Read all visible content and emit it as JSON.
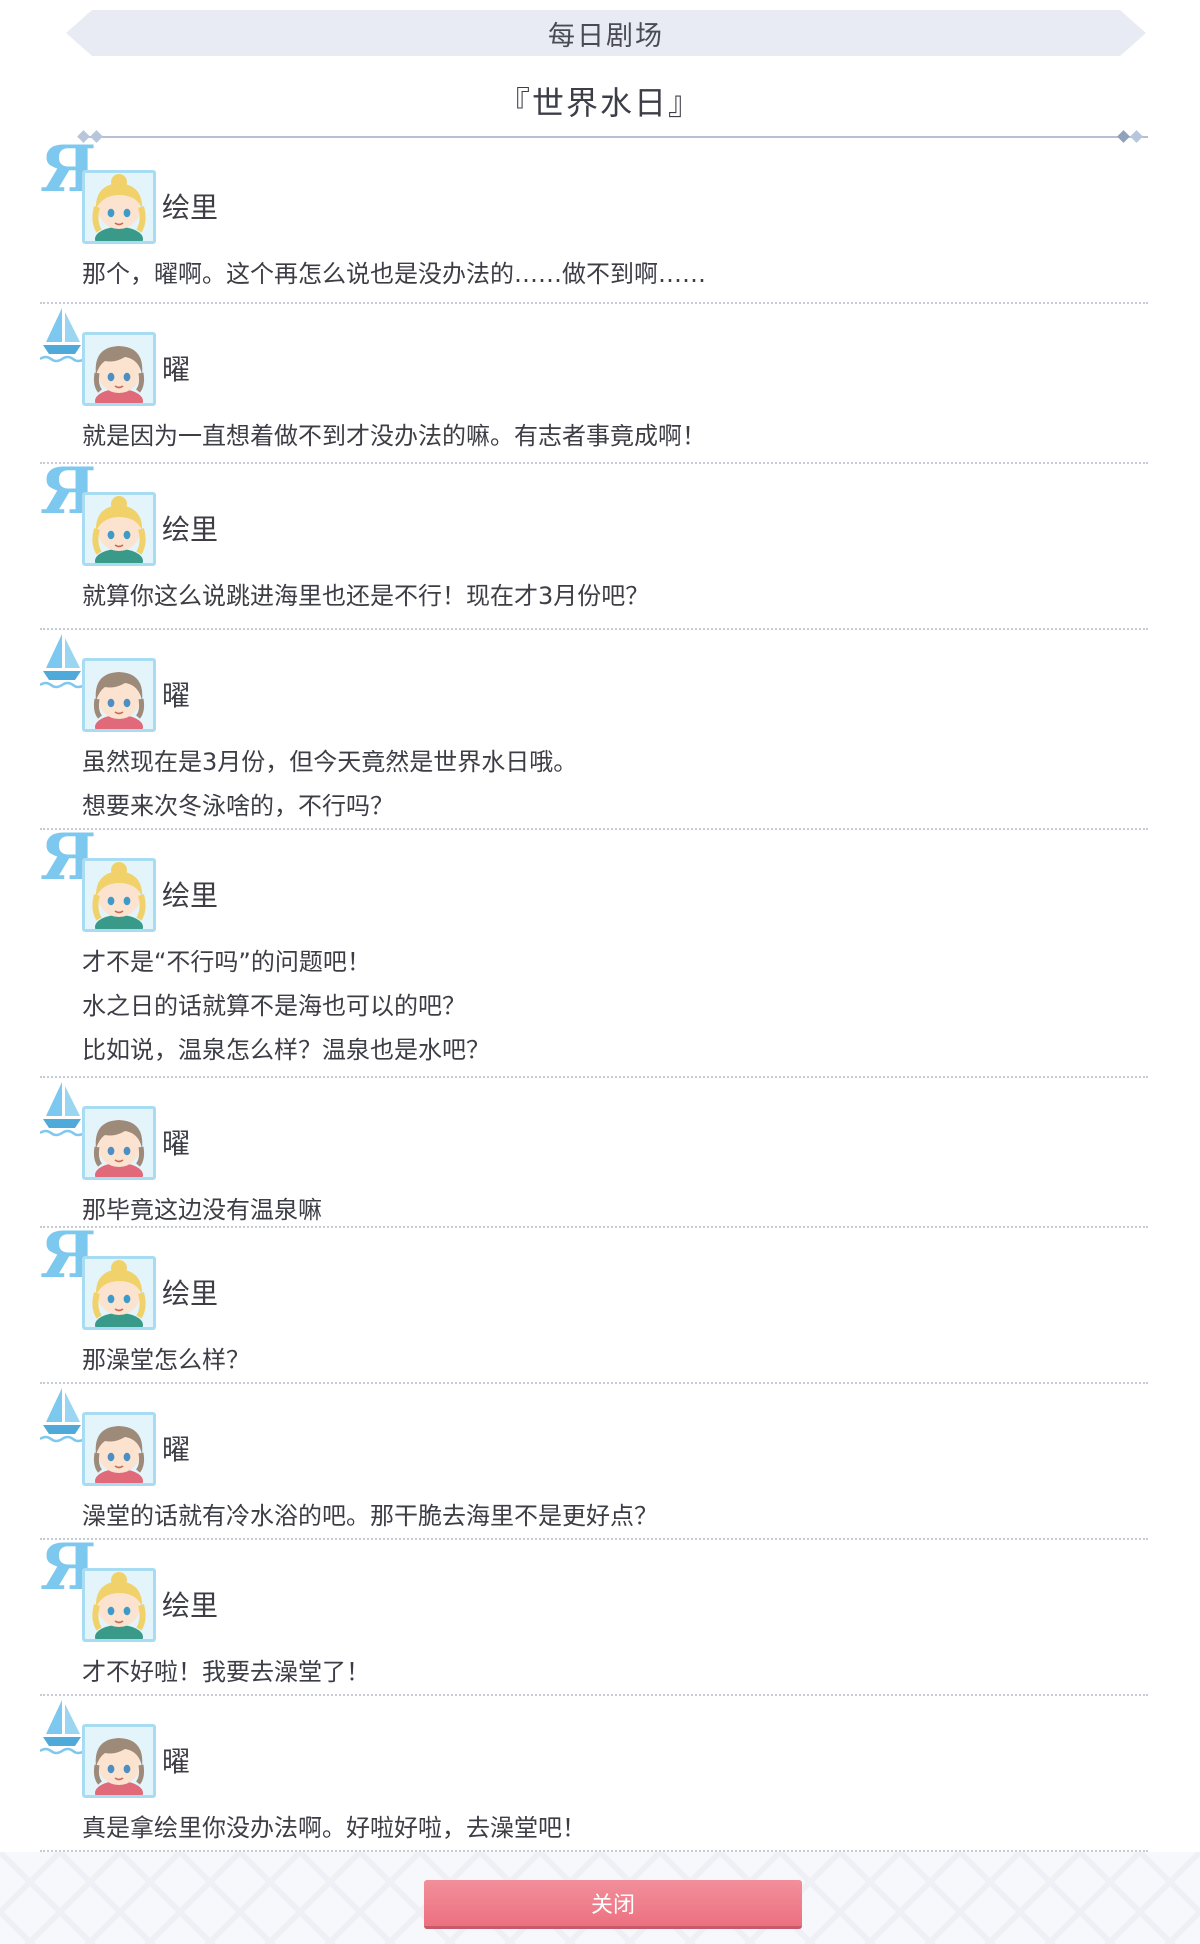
{
  "header": {
    "title": "每日剧场"
  },
  "story": {
    "title": "『世界水日』"
  },
  "icons": {
    "otonokizaka": "otonokizaka-school-icon",
    "uranohoshi": "uranohoshi-school-icon",
    "accent_light_blue": "#7dc8ee"
  },
  "dialogues": [
    {
      "speaker": "绘里",
      "lines": [
        "那个，曜啊。这个再怎么说也是没办法的……做不到啊……"
      ]
    },
    {
      "speaker": "曜",
      "lines": [
        "就是因为一直想着做不到才没办法的嘛。有志者事竟成啊！"
      ]
    },
    {
      "speaker": "绘里",
      "lines": [
        "就算你这么说跳进海里也还是不行！现在才3月份吧？"
      ]
    },
    {
      "speaker": "曜",
      "lines": [
        "虽然现在是3月份，但今天竟然是世界水日哦。",
        "想要来次冬泳啥的，不行吗？"
      ]
    },
    {
      "speaker": "绘里",
      "lines": [
        "才不是“不行吗”的问题吧！",
        "水之日的话就算不是海也可以的吧？",
        "比如说，温泉怎么样？温泉也是水吧？"
      ]
    },
    {
      "speaker": "曜",
      "lines": [
        "那毕竟这边没有温泉嘛"
      ]
    },
    {
      "speaker": "绘里",
      "lines": [
        "那澡堂怎么样？"
      ]
    },
    {
      "speaker": "曜",
      "lines": [
        "澡堂的话就有冷水浴的吧。那干脆去海里不是更好点？"
      ]
    },
    {
      "speaker": "绘里",
      "lines": [
        "才不好啦！我要去澡堂了！"
      ]
    },
    {
      "speaker": "曜",
      "lines": [
        "真是拿绘里你没办法啊。好啦好啦，去澡堂吧！"
      ]
    }
  ],
  "footer": {
    "close_label": "关闭",
    "button_color": "#ec7180"
  }
}
